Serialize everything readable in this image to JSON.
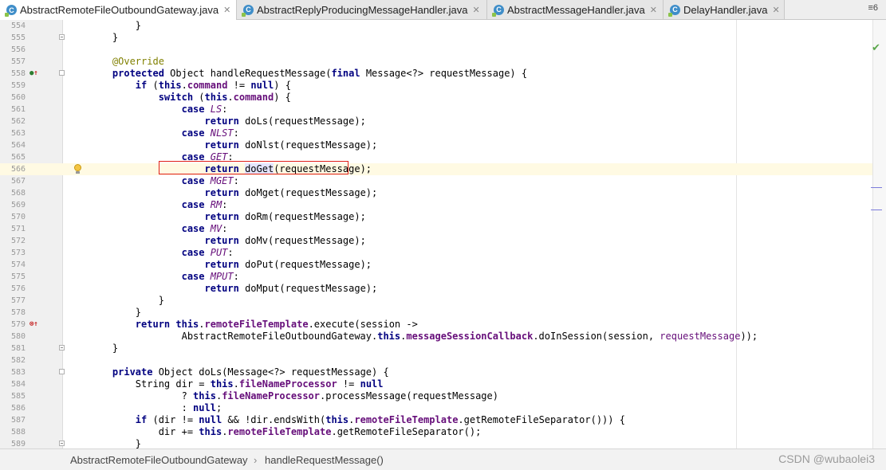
{
  "tabs": [
    {
      "label": "AbstractRemoteFileOutboundGateway.java",
      "active": true
    },
    {
      "label": "AbstractReplyProducingMessageHandler.java",
      "active": false
    },
    {
      "label": "AbstractMessageHandler.java",
      "active": false
    },
    {
      "label": "DelayHandler.java",
      "active": false
    }
  ],
  "tab_icon_letter": "C",
  "tab_close": "✕",
  "tab_overflow": "≡6",
  "breadcrumb": [
    "AbstractRemoteFileOutboundGateway",
    "handleRequestMessage()"
  ],
  "breadcrumb_separator": "›",
  "watermark": "CSDN @wubaolei3",
  "lines": [
    {
      "n": "554",
      "segs": [
        [
          "",
          "        }"
        ]
      ]
    },
    {
      "n": "555",
      "segs": [
        [
          "",
          "    }"
        ]
      ]
    },
    {
      "n": "556",
      "segs": []
    },
    {
      "n": "557",
      "segs": [
        [
          "ann",
          "    @Override"
        ]
      ]
    },
    {
      "n": "558",
      "segs": [
        [
          "kw",
          "    protected "
        ],
        [
          "",
          "Object handleRequestMessage("
        ],
        [
          "kw",
          "final "
        ],
        [
          "",
          "Message<?> requestMessage) {"
        ]
      ]
    },
    {
      "n": "559",
      "segs": [
        [
          "kw",
          "        if "
        ],
        [
          "",
          "("
        ],
        [
          "kw",
          "this"
        ],
        [
          "",
          "."
        ],
        [
          "fld",
          "command"
        ],
        [
          "",
          " != "
        ],
        [
          "kw",
          "null"
        ],
        [
          "",
          ") {"
        ]
      ]
    },
    {
      "n": "560",
      "segs": [
        [
          "kw",
          "            switch "
        ],
        [
          "",
          "("
        ],
        [
          "kw",
          "this"
        ],
        [
          "",
          "."
        ],
        [
          "fld",
          "command"
        ],
        [
          "",
          ") {"
        ]
      ]
    },
    {
      "n": "561",
      "segs": [
        [
          "kw",
          "                case "
        ],
        [
          "enumc",
          "LS"
        ],
        [
          "",
          ":"
        ]
      ]
    },
    {
      "n": "562",
      "segs": [
        [
          "kw",
          "                    return "
        ],
        [
          "",
          "doLs(requestMessage);"
        ]
      ]
    },
    {
      "n": "563",
      "segs": [
        [
          "kw",
          "                case "
        ],
        [
          "enumc",
          "NLST"
        ],
        [
          "",
          ":"
        ]
      ]
    },
    {
      "n": "564",
      "segs": [
        [
          "kw",
          "                    return "
        ],
        [
          "",
          "doNlst(requestMessage);"
        ]
      ]
    },
    {
      "n": "565",
      "segs": [
        [
          "kw",
          "                case "
        ],
        [
          "enumc",
          "GET"
        ],
        [
          "",
          ":"
        ]
      ]
    },
    {
      "n": "566",
      "segs": [
        [
          "kw",
          "                    return "
        ],
        [
          "doget",
          "doGet"
        ],
        [
          "",
          "(requestMessage);"
        ]
      ]
    },
    {
      "n": "567",
      "segs": [
        [
          "kw",
          "                case "
        ],
        [
          "enumc",
          "MGET"
        ],
        [
          "",
          ":"
        ]
      ]
    },
    {
      "n": "568",
      "segs": [
        [
          "kw",
          "                    return "
        ],
        [
          "",
          "doMget(requestMessage);"
        ]
      ]
    },
    {
      "n": "569",
      "segs": [
        [
          "kw",
          "                case "
        ],
        [
          "enumc",
          "RM"
        ],
        [
          "",
          ":"
        ]
      ]
    },
    {
      "n": "570",
      "segs": [
        [
          "kw",
          "                    return "
        ],
        [
          "",
          "doRm(requestMessage);"
        ]
      ]
    },
    {
      "n": "571",
      "segs": [
        [
          "kw",
          "                case "
        ],
        [
          "enumc",
          "MV"
        ],
        [
          "",
          ":"
        ]
      ]
    },
    {
      "n": "572",
      "segs": [
        [
          "kw",
          "                    return "
        ],
        [
          "",
          "doMv(requestMessage);"
        ]
      ]
    },
    {
      "n": "573",
      "segs": [
        [
          "kw",
          "                case "
        ],
        [
          "enumc",
          "PUT"
        ],
        [
          "",
          ":"
        ]
      ]
    },
    {
      "n": "574",
      "segs": [
        [
          "kw",
          "                    return "
        ],
        [
          "",
          "doPut(requestMessage);"
        ]
      ]
    },
    {
      "n": "575",
      "segs": [
        [
          "kw",
          "                case "
        ],
        [
          "enumc",
          "MPUT"
        ],
        [
          "",
          ":"
        ]
      ]
    },
    {
      "n": "576",
      "segs": [
        [
          "kw",
          "                    return "
        ],
        [
          "",
          "doMput(requestMessage);"
        ]
      ]
    },
    {
      "n": "577",
      "segs": [
        [
          "",
          "            }"
        ]
      ]
    },
    {
      "n": "578",
      "segs": [
        [
          "",
          "        }"
        ]
      ]
    },
    {
      "n": "579",
      "segs": [
        [
          "kw",
          "        return this"
        ],
        [
          "",
          "."
        ],
        [
          "fld",
          "remoteFileTemplate"
        ],
        [
          "",
          ".execute(session ->"
        ]
      ]
    },
    {
      "n": "580",
      "segs": [
        [
          "",
          "                AbstractRemoteFileOutboundGateway."
        ],
        [
          "kw",
          "this"
        ],
        [
          "",
          "."
        ],
        [
          "fld",
          "messageSessionCallback"
        ],
        [
          "",
          ".doInSession(session, "
        ],
        [
          "param",
          "requestMessage"
        ],
        [
          "",
          "));"
        ]
      ]
    },
    {
      "n": "581",
      "segs": [
        [
          "",
          "    }"
        ]
      ]
    },
    {
      "n": "582",
      "segs": []
    },
    {
      "n": "583",
      "segs": [
        [
          "kw",
          "    private "
        ],
        [
          "",
          "Object doLs(Message<?> requestMessage) {"
        ]
      ]
    },
    {
      "n": "584",
      "segs": [
        [
          "",
          "        String dir = "
        ],
        [
          "kw",
          "this"
        ],
        [
          "",
          "."
        ],
        [
          "fld",
          "fileNameProcessor"
        ],
        [
          "",
          " != "
        ],
        [
          "kw",
          "null"
        ]
      ]
    },
    {
      "n": "585",
      "segs": [
        [
          "",
          "                ? "
        ],
        [
          "kw",
          "this"
        ],
        [
          "",
          "."
        ],
        [
          "fld",
          "fileNameProcessor"
        ],
        [
          "",
          ".processMessage(requestMessage)"
        ]
      ]
    },
    {
      "n": "586",
      "segs": [
        [
          "",
          "                : "
        ],
        [
          "kw",
          "null"
        ],
        [
          "",
          ";"
        ]
      ]
    },
    {
      "n": "587",
      "segs": [
        [
          "kw",
          "        if "
        ],
        [
          "",
          "(dir != "
        ],
        [
          "kw",
          "null"
        ],
        [
          "",
          " && !dir.endsWith("
        ],
        [
          "kw",
          "this"
        ],
        [
          "",
          "."
        ],
        [
          "fld",
          "remoteFileTemplate"
        ],
        [
          "",
          ".getRemoteFileSeparator())) {"
        ]
      ]
    },
    {
      "n": "588",
      "segs": [
        [
          "",
          "            dir += "
        ],
        [
          "kw",
          "this"
        ],
        [
          "",
          "."
        ],
        [
          "fld",
          "remoteFileTemplate"
        ],
        [
          "",
          ".getRemoteFileSeparator();"
        ]
      ]
    },
    {
      "n": "589",
      "segs": [
        [
          "",
          "        }"
        ]
      ]
    }
  ],
  "gutter_markers": {
    "558": "override",
    "579": "error"
  },
  "fold_markers": {
    "555": "end",
    "558": "start",
    "581": "end",
    "583": "start",
    "589": "end"
  },
  "caret_line": "566",
  "colors": {
    "keyword": "#000080",
    "field": "#660e7a",
    "annotation": "#808000",
    "highlight_box": "#e0201a"
  }
}
